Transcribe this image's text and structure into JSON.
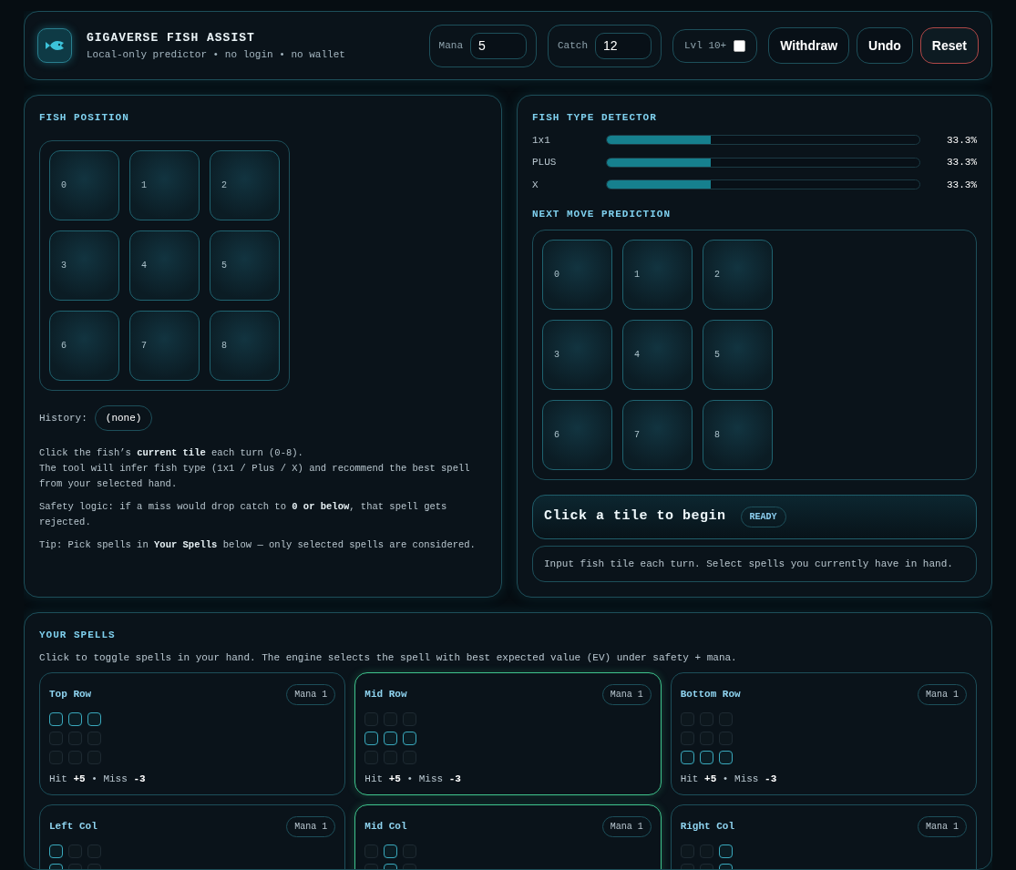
{
  "header": {
    "title": "GIGAVERSE FISH ASSIST",
    "subtitle": "Local-only predictor • no login • no wallet",
    "fields": [
      {
        "label": "Mana",
        "value": "5"
      },
      {
        "label": "Catch",
        "value": "12"
      }
    ],
    "level_toggle": {
      "label": "Lvl 10+",
      "checked": false
    },
    "buttons": [
      {
        "label": "Withdraw",
        "kind": "normal"
      },
      {
        "label": "Undo",
        "kind": "normal"
      },
      {
        "label": "Reset",
        "kind": "danger"
      }
    ]
  },
  "fish_position": {
    "title": "FISH POSITION",
    "tiles": [
      "0",
      "1",
      "2",
      "3",
      "4",
      "5",
      "6",
      "7",
      "8"
    ],
    "history_label": "History:",
    "history_value": "(none)",
    "notes": [
      "Click the fish’s **current tile** each turn (0-8).\nThe tool will infer fish type (1x1 / Plus / X) and recommend the best spell from your selected hand.",
      "Safety logic: if a miss would drop catch to **0 or below**, that spell gets rejected.",
      "Tip: Pick spells in **Your Spells** below — only selected spells are considered."
    ]
  },
  "detector": {
    "title": "FISH TYPE DETECTOR",
    "types": [
      {
        "name": "1x1",
        "level": 0.333,
        "reading": "33.3%"
      },
      {
        "name": "PLUS",
        "level": 0.333,
        "reading": "33.3%"
      },
      {
        "name": "X",
        "level": 0.333,
        "reading": "33.3%"
      }
    ]
  },
  "prediction": {
    "title": "NEXT MOVE PREDICTION",
    "tiles": [
      "0",
      "1",
      "2",
      "3",
      "4",
      "5",
      "6",
      "7",
      "8"
    ],
    "status_text": "Click a tile to begin",
    "status_badge": "READY",
    "hint": "Input fish tile each turn. Select spells you currently have in hand."
  },
  "spells": {
    "title": "YOUR SPELLS",
    "intro": "Click to toggle spells in your hand. The engine selects the spell with best expected value (EV) under safety + mana.",
    "items": [
      {
        "name": "Top Row",
        "mana": "Mana 1",
        "selected": false,
        "cells": [
          true,
          true,
          true,
          false,
          false,
          false,
          false,
          false,
          false
        ],
        "hit_label": "Hit",
        "hit": "+5",
        "separator": "•",
        "miss_label": "Miss",
        "miss": "-3"
      },
      {
        "name": "Mid Row",
        "mana": "Mana 1",
        "selected": true,
        "cells": [
          false,
          false,
          false,
          true,
          true,
          true,
          false,
          false,
          false
        ],
        "hit_label": "Hit",
        "hit": "+5",
        "separator": "•",
        "miss_label": "Miss",
        "miss": "-3"
      },
      {
        "name": "Bottom Row",
        "mana": "Mana 1",
        "selected": false,
        "cells": [
          false,
          false,
          false,
          false,
          false,
          false,
          true,
          true,
          true
        ],
        "hit_label": "Hit",
        "hit": "+5",
        "separator": "•",
        "miss_label": "Miss",
        "miss": "-3"
      },
      {
        "name": "Left Col",
        "mana": "Mana 1",
        "selected": false,
        "cells": [
          true,
          false,
          false,
          true,
          false,
          false
        ]
      },
      {
        "name": "Mid Col",
        "mana": "Mana 1",
        "selected": true,
        "cells": [
          false,
          true,
          false,
          false,
          true,
          false
        ]
      },
      {
        "name": "Right Col",
        "mana": "Mana 1",
        "selected": false,
        "cells": [
          false,
          false,
          true,
          false,
          false,
          true
        ]
      }
    ]
  }
}
